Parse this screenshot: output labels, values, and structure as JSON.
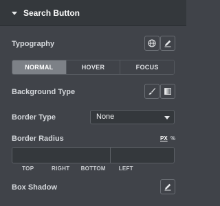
{
  "section": {
    "title": "Search Button"
  },
  "typography": {
    "label": "Typography",
    "icons": [
      "globe-icon",
      "pencil-icon"
    ]
  },
  "tabs": [
    {
      "label": "NORMAL",
      "active": true
    },
    {
      "label": "HOVER",
      "active": false
    },
    {
      "label": "FOCUS",
      "active": false
    }
  ],
  "background_type": {
    "label": "Background Type",
    "icons": [
      "brush-icon",
      "gradient-icon"
    ]
  },
  "border_type": {
    "label": "Border Type",
    "value": "None"
  },
  "border_radius": {
    "label": "Border Radius",
    "units": [
      {
        "label": "PX",
        "active": true
      },
      {
        "label": "%",
        "active": false
      }
    ],
    "fields": [
      {
        "label": "TOP",
        "value": ""
      },
      {
        "label": "RIGHT",
        "value": ""
      },
      {
        "label": "BOTTOM",
        "value": ""
      },
      {
        "label": "LEFT",
        "value": ""
      }
    ],
    "link_icon": "link-icon"
  },
  "box_shadow": {
    "label": "Box Shadow",
    "icon": "pencil-icon"
  },
  "colors": {
    "panel_bg": "#404349",
    "header_bg": "#34383c",
    "active_tab_bg": "#7d8187",
    "input_bg": "#34383c",
    "text": "#e0e1e3"
  }
}
